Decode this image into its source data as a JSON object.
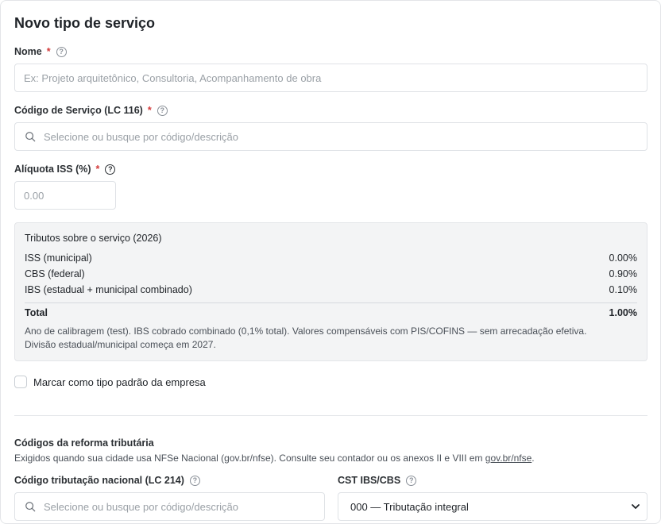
{
  "form": {
    "title": "Novo tipo de serviço",
    "required_mark": "*",
    "help_glyph": "?"
  },
  "nome": {
    "label": "Nome",
    "placeholder": "Ex: Projeto arquitetônico, Consultoria, Acompanhamento de obra",
    "value": ""
  },
  "codigo_servico": {
    "label": "Código de Serviço (LC 116)",
    "placeholder": "Selecione ou busque por código/descrição",
    "value": ""
  },
  "aliquota": {
    "label": "Alíquota ISS (%)",
    "placeholder": "0.00",
    "value": ""
  },
  "tributos": {
    "title": "Tributos sobre o serviço (2026)",
    "rows": [
      {
        "label": "ISS (municipal)",
        "value": "0.00%"
      },
      {
        "label": "CBS (federal)",
        "value": "0.90%"
      },
      {
        "label": "IBS (estadual + municipal combinado)",
        "value": "0.10%"
      }
    ],
    "total_label": "Total",
    "total_value": "1.00%",
    "note": "Ano de calibragem (test). IBS cobrado combinado (0,1% total). Valores compensáveis com PIS/COFINS — sem arrecadação efetiva. Divisão estadual/municipal começa em 2027."
  },
  "padrao": {
    "label": "Marcar como tipo padrão da empresa",
    "checked": false
  },
  "reforma": {
    "title": "Códigos da reforma tributária",
    "subtitle": "Exigidos quando sua cidade usa NFSe Nacional (gov.br/nfse). Consulte seu contador ou os anexos II e VIII em ",
    "link": "gov.br/nfse",
    "subtitle_end": ".",
    "codigo_nacional": {
      "label": "Código tributação nacional (LC 214)",
      "placeholder": "Selecione ou busque por código/descrição"
    },
    "cst": {
      "label": "CST IBS/CBS",
      "selected": "000 — Tributação integral"
    }
  },
  "icons": {
    "search": "search-icon",
    "help": "help-circle-icon",
    "chevron": "chevron-down-icon"
  },
  "colors": {
    "required": "#d33a3a",
    "panel_bg": "#f3f4f5",
    "border": "#dfe2e6"
  }
}
